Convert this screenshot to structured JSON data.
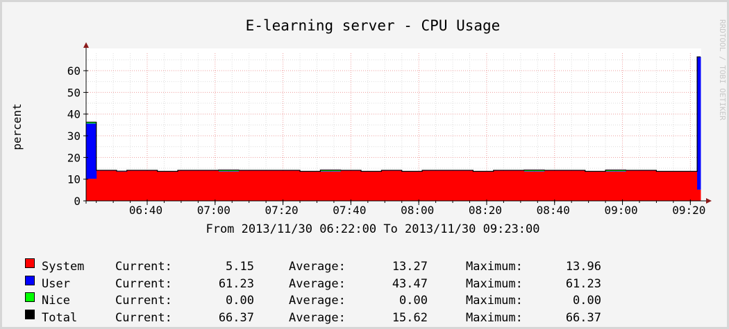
{
  "chart_data": {
    "type": "area",
    "title": "E-learning server - CPU Usage",
    "ylabel": "percent",
    "xlabel": "From 2013/11/30 06:22:00 To 2013/11/30 09:23:00",
    "watermark": "RRDTOOL / TOBI OETIKER",
    "ylim": [
      0,
      68
    ],
    "y_ticks": [
      0,
      10,
      20,
      30,
      40,
      50,
      60
    ],
    "x_ticks": [
      "06:40",
      "07:00",
      "07:20",
      "07:40",
      "08:00",
      "08:20",
      "08:40",
      "09:00",
      "09:20"
    ],
    "x_range": [
      "06:22",
      "09:23"
    ],
    "grid": true,
    "stacked": true,
    "x": [
      "06:22",
      "06:25",
      "06:28",
      "06:31",
      "06:34",
      "06:37",
      "06:40",
      "06:43",
      "06:46",
      "06:49",
      "06:52",
      "06:55",
      "06:58",
      "07:01",
      "07:04",
      "07:07",
      "07:10",
      "07:13",
      "07:16",
      "07:19",
      "07:22",
      "07:25",
      "07:28",
      "07:31",
      "07:34",
      "07:37",
      "07:40",
      "07:43",
      "07:46",
      "07:49",
      "07:52",
      "07:55",
      "07:58",
      "08:01",
      "08:04",
      "08:07",
      "08:10",
      "08:13",
      "08:16",
      "08:19",
      "08:22",
      "08:25",
      "08:28",
      "08:31",
      "08:34",
      "08:37",
      "08:40",
      "08:43",
      "08:46",
      "08:49",
      "08:52",
      "08:55",
      "08:58",
      "09:01",
      "09:04",
      "09:07",
      "09:10",
      "09:13",
      "09:16",
      "09:19",
      "09:22"
    ],
    "series": [
      {
        "name": "System",
        "color": "#ff0000",
        "values": [
          10.2,
          13.9,
          13.9,
          13.5,
          13.9,
          13.9,
          13.9,
          13.4,
          13.4,
          13.9,
          13.9,
          13.9,
          13.9,
          13.5,
          13.5,
          13.9,
          13.9,
          13.9,
          13.9,
          13.9,
          13.9,
          13.4,
          13.4,
          13.5,
          13.5,
          13.9,
          13.9,
          13.4,
          13.4,
          13.9,
          13.9,
          13.4,
          13.4,
          13.9,
          13.9,
          13.9,
          13.9,
          13.9,
          13.4,
          13.4,
          13.9,
          13.9,
          13.9,
          13.5,
          13.5,
          13.9,
          13.9,
          13.9,
          13.9,
          13.4,
          13.4,
          13.5,
          13.5,
          13.9,
          13.9,
          13.9,
          13.4,
          13.4,
          13.4,
          13.4,
          5.15
        ]
      },
      {
        "name": "User",
        "color": "#0000ff",
        "values": [
          25.5,
          0.2,
          0.2,
          0.2,
          0.2,
          0.2,
          0.2,
          0.2,
          0.2,
          0.2,
          0.2,
          0.2,
          0.2,
          0.2,
          0.2,
          0.2,
          0.2,
          0.2,
          0.2,
          0.2,
          0.2,
          0.2,
          0.2,
          0.2,
          0.2,
          0.2,
          0.2,
          0.2,
          0.2,
          0.2,
          0.2,
          0.2,
          0.2,
          0.2,
          0.2,
          0.2,
          0.2,
          0.2,
          0.2,
          0.2,
          0.2,
          0.2,
          0.2,
          0.2,
          0.2,
          0.2,
          0.2,
          0.2,
          0.2,
          0.2,
          0.2,
          0.2,
          0.2,
          0.2,
          0.2,
          0.2,
          0.2,
          0.2,
          0.2,
          0.2,
          61.23
        ]
      },
      {
        "name": "Nice",
        "color": "#00ff00",
        "values": [
          0.6,
          0,
          0,
          0,
          0,
          0,
          0,
          0,
          0,
          0,
          0,
          0,
          0,
          0.5,
          0.5,
          0,
          0,
          0,
          0,
          0,
          0,
          0,
          0,
          0.5,
          0.5,
          0,
          0,
          0,
          0,
          0,
          0,
          0,
          0,
          0,
          0,
          0,
          0,
          0,
          0,
          0,
          0,
          0,
          0,
          0.5,
          0.5,
          0,
          0,
          0,
          0,
          0,
          0,
          0.5,
          0.5,
          0,
          0,
          0,
          0,
          0,
          0,
          0,
          0
        ]
      },
      {
        "name": "Total",
        "color": "#000000",
        "values": []
      }
    ]
  },
  "legend": [
    {
      "name": "System",
      "color": "#ff0000",
      "current_label": "Current:",
      "current": "5.15",
      "average_label": "Average:",
      "average": "13.27",
      "maximum_label": "Maximum:",
      "maximum": "13.96"
    },
    {
      "name": "User",
      "color": "#0000ff",
      "current_label": "Current:",
      "current": "61.23",
      "average_label": "Average:",
      "average": "43.47",
      "maximum_label": "Maximum:",
      "maximum": "61.23"
    },
    {
      "name": "Nice",
      "color": "#00ff00",
      "current_label": "Current:",
      "current": "0.00",
      "average_label": "Average:",
      "average": "0.00",
      "maximum_label": "Maximum:",
      "maximum": "0.00"
    },
    {
      "name": "Total",
      "color": "#000000",
      "current_label": "Current:",
      "current": "66.37",
      "average_label": "Average:",
      "average": "15.62",
      "maximum_label": "Maximum:",
      "maximum": "66.37"
    }
  ]
}
